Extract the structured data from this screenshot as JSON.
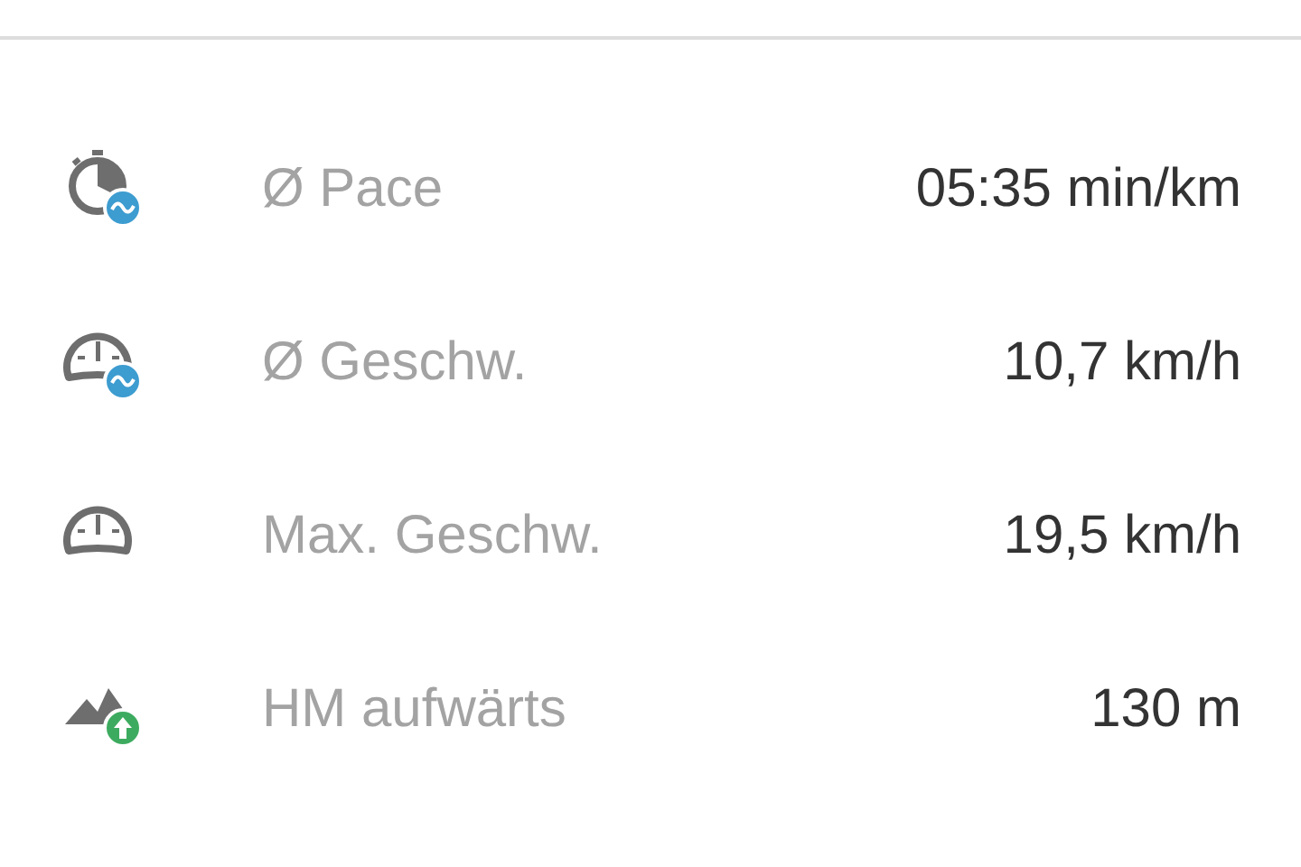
{
  "stats": [
    {
      "kind": "pace",
      "label": "Ø Pace",
      "value": "05:35 min/km"
    },
    {
      "kind": "average",
      "label": "Ø Geschw.",
      "value": "10,7 km/h"
    },
    {
      "kind": "maximum",
      "label": "Max. Geschw.",
      "value": "19,5 km/h"
    },
    {
      "kind": "ascent",
      "label": "HM aufwärts",
      "value": "130 m"
    }
  ]
}
